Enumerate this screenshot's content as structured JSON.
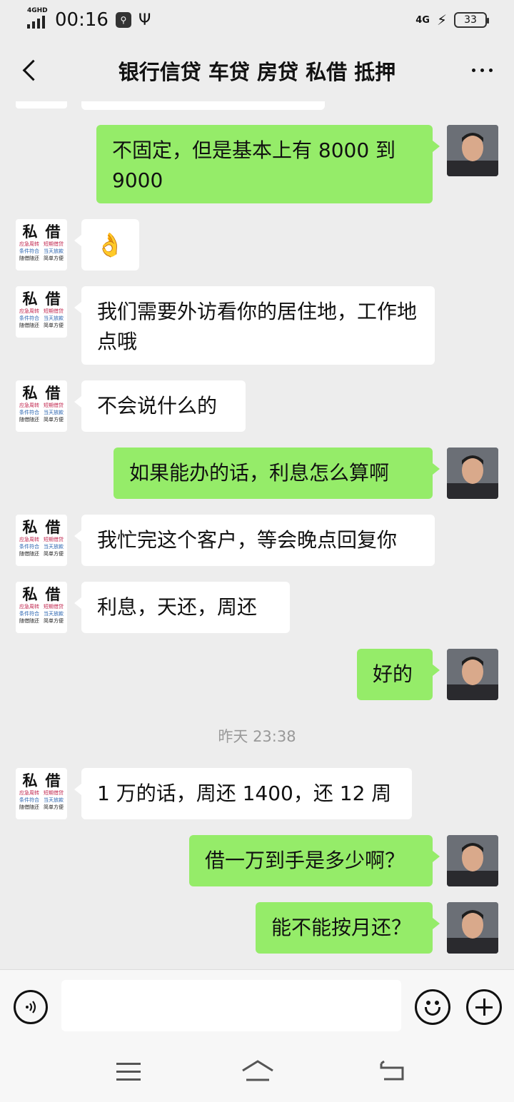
{
  "status_bar": {
    "network": "4GHD",
    "time": "00:16",
    "usb_label": "USB",
    "network_right": "4G",
    "battery": "33"
  },
  "header": {
    "title": "银行信贷 车贷 房贷 私借 抵押"
  },
  "contact_avatar": {
    "title_left": "私",
    "title_right": "借",
    "rows": [
      [
        "应急周转",
        "短期借贷"
      ],
      [
        "条件符合",
        "当天放款"
      ],
      [
        "随借随还",
        "简单方便"
      ]
    ]
  },
  "messages": [
    {
      "side": "right",
      "text": "不固定，但是基本上有 8000 到 9000"
    },
    {
      "side": "left",
      "text": "👌"
    },
    {
      "side": "left",
      "text": "我们需要外访看你的居住地，工作地点哦"
    },
    {
      "side": "left",
      "text": "不会说什么的"
    },
    {
      "side": "right",
      "text": "如果能办的话，利息怎么算啊"
    },
    {
      "side": "left",
      "text": "我忙完这个客户，等会晚点回复你"
    },
    {
      "side": "left",
      "text": "利息，天还，周还"
    },
    {
      "side": "right",
      "text": "好的"
    },
    {
      "side": "left",
      "text": "1 万的话，周还 1400，还 12 周"
    },
    {
      "side": "right",
      "text": "借一万到手是多少啊？"
    },
    {
      "side": "right",
      "text": "能不能按月还？"
    }
  ],
  "timestamp": "昨天 23:38",
  "input": {
    "value": "",
    "placeholder": ""
  },
  "colors": {
    "background": "#ededed",
    "bubble_sent": "#95ec69",
    "bubble_received": "#ffffff"
  }
}
